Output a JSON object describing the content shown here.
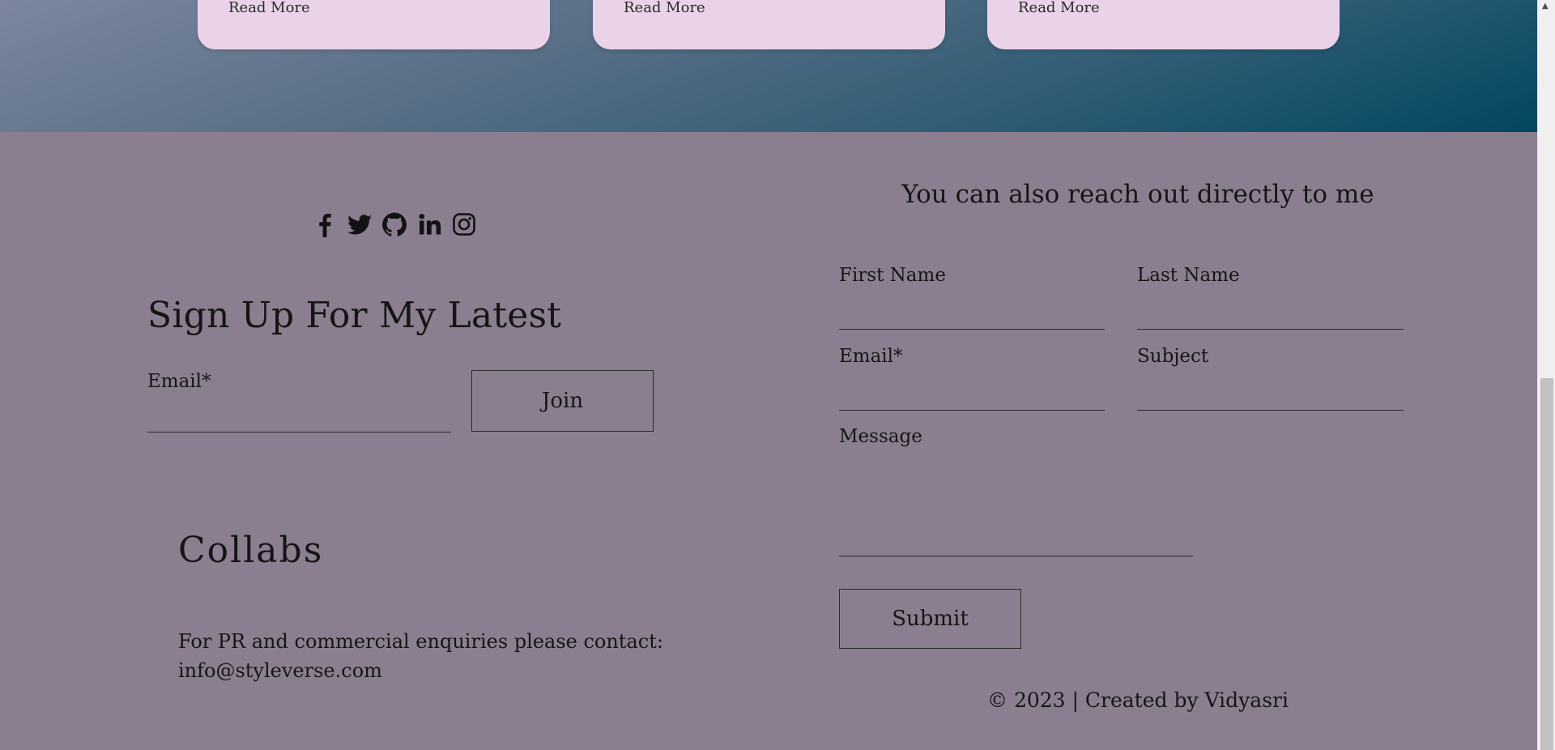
{
  "cards": [
    {
      "read_more": "Read More"
    },
    {
      "read_more": "Read More"
    },
    {
      "read_more": "Read More"
    }
  ],
  "social": {
    "icons": [
      "facebook-icon",
      "twitter-icon",
      "github-icon",
      "linkedin-icon",
      "instagram-icon"
    ]
  },
  "signup": {
    "title": "Sign Up For My Latest",
    "email_label": "Email*",
    "email_value": "",
    "join_label": "Join"
  },
  "collabs": {
    "title": "Collabs",
    "text_line1": "For PR and commercial enquiries please contact:",
    "email": "info@styleverse.com"
  },
  "contact": {
    "title": "You can also reach out directly to me",
    "first_name_label": "First Name",
    "last_name_label": "Last Name",
    "email_label": "Email*",
    "subject_label": "Subject",
    "message_label": "Message",
    "submit_label": "Submit"
  },
  "footer": {
    "copyright": "© 2023 | Created by Vidyasri"
  },
  "colors": {
    "footer_bg": "#8c7e91",
    "card_bg": "#ead3e8",
    "banner_gradient_end": "#024760"
  }
}
